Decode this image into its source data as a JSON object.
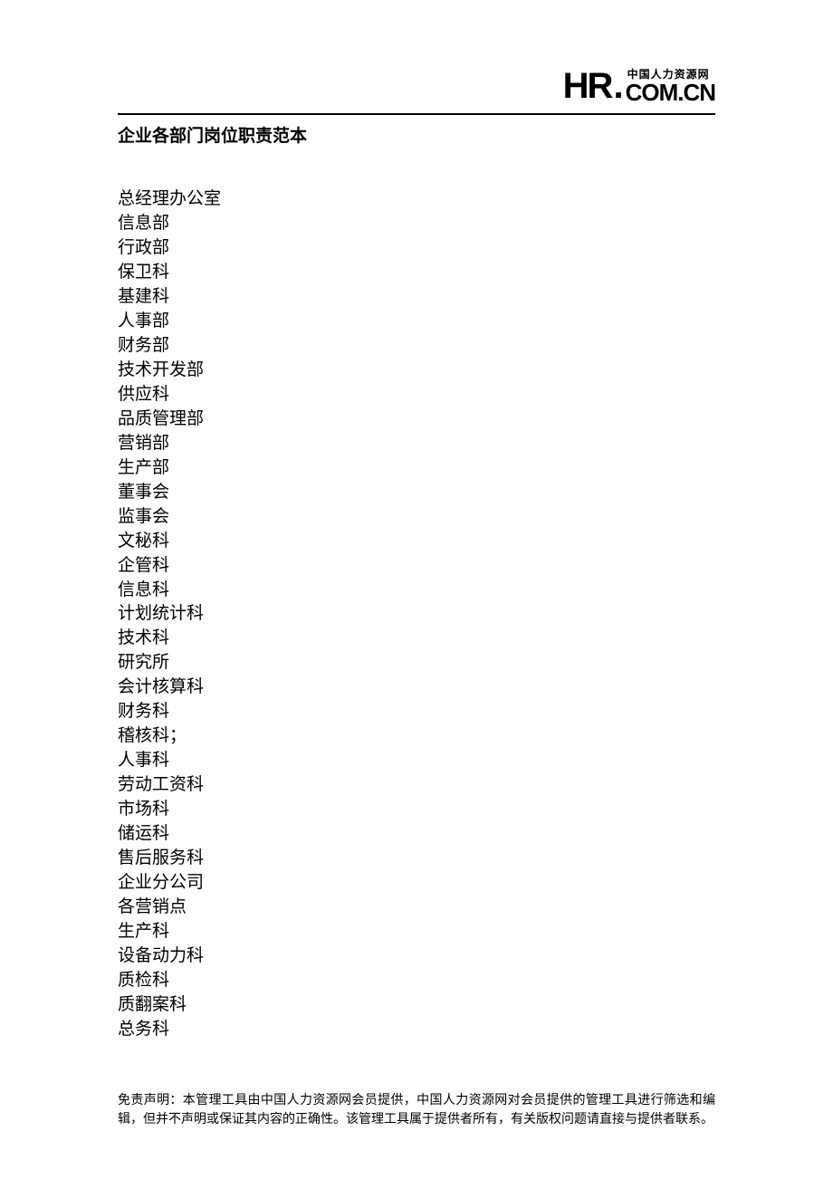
{
  "logo": {
    "hr": "HR",
    "dot": ".",
    "subtitle": "中国人力资源网",
    "comcn": "COM.CN"
  },
  "title": "企业各部门岗位职责范本",
  "departments": [
    "总经理办公室",
    "信息部",
    "行政部",
    "保卫科",
    "基建科",
    "人事部",
    "财务部",
    "技术开发部",
    "供应科",
    "品质管理部",
    "营销部",
    "生产部",
    "董事会",
    "监事会",
    "文秘科",
    "企管科",
    "信息科",
    "计划统计科",
    "技术科",
    "研究所",
    "会计核算科",
    "财务科",
    "稽核科；",
    "人事科",
    "劳动工资科",
    "市场科",
    "储运科",
    "售后服务科",
    "企业分公司",
    "各营销点",
    "生产科",
    "设备动力科",
    "质检科",
    "质翻案科",
    "总务科"
  ],
  "footer": "免责声明：本管理工具由中国人力资源网会员提供，中国人力资源网对会员提供的管理工具进行筛选和编辑，但并不声明或保证其内容的正确性。该管理工具属于提供者所有，有关版权问题请直接与提供者联系。"
}
